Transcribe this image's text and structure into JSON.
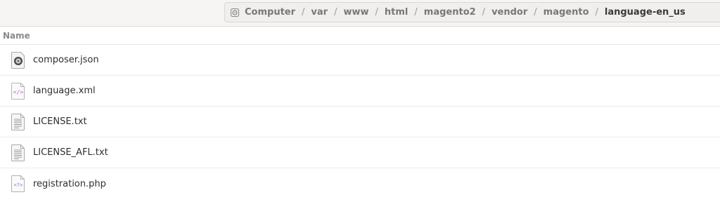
{
  "breadcrumb": {
    "items": [
      "Computer",
      "var",
      "www",
      "html",
      "magento2",
      "vendor",
      "magento",
      "language-en_us"
    ],
    "separator": "/"
  },
  "columns": {
    "name_header": "Name"
  },
  "files": [
    {
      "name": "composer.json",
      "icon": "json-file-icon"
    },
    {
      "name": "language.xml",
      "icon": "xml-file-icon"
    },
    {
      "name": "LICENSE.txt",
      "icon": "text-file-icon"
    },
    {
      "name": "LICENSE_AFL.txt",
      "icon": "text-file-icon"
    },
    {
      "name": "registration.php",
      "icon": "php-file-icon"
    }
  ]
}
